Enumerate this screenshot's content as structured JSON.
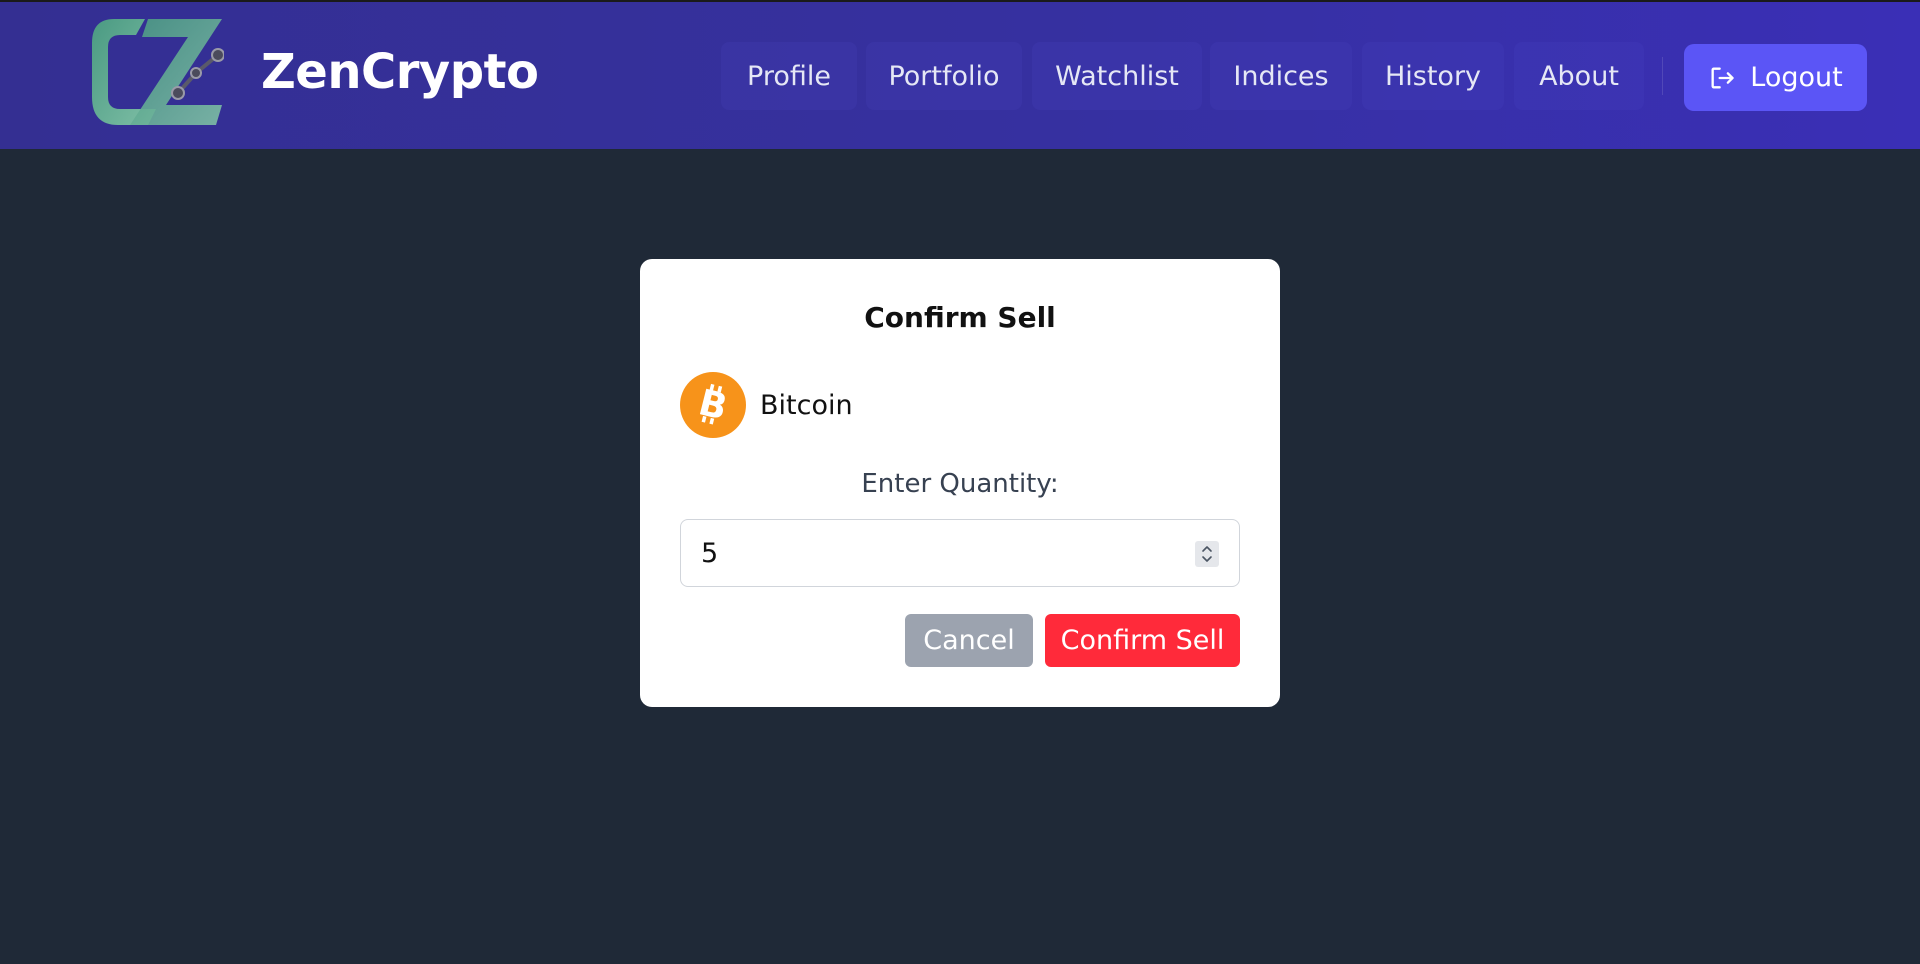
{
  "navbar": {
    "brand": "ZenCrypto",
    "items": [
      {
        "label": "Profile"
      },
      {
        "label": "Portfolio"
      },
      {
        "label": "Watchlist"
      },
      {
        "label": "Indices"
      },
      {
        "label": "History"
      },
      {
        "label": "About"
      }
    ],
    "logout_label": "Logout",
    "icons": {
      "logo": "zencrypto-logo",
      "logout": "logout-icon"
    }
  },
  "modal": {
    "title": "Confirm Sell",
    "coin": {
      "name": "Bitcoin",
      "icon": "bitcoin-icon"
    },
    "quantity_label": "Enter Quantity:",
    "quantity_value": "5",
    "cancel_label": "Cancel",
    "confirm_label": "Confirm Sell"
  },
  "colors": {
    "navbar_bg": "#3630a0",
    "page_bg": "#1f2937",
    "logout_bg": "#5b55f6",
    "cancel_bg": "#9ca3af",
    "confirm_bg": "#ff2a3a",
    "bitcoin_orange": "#f7931a"
  }
}
